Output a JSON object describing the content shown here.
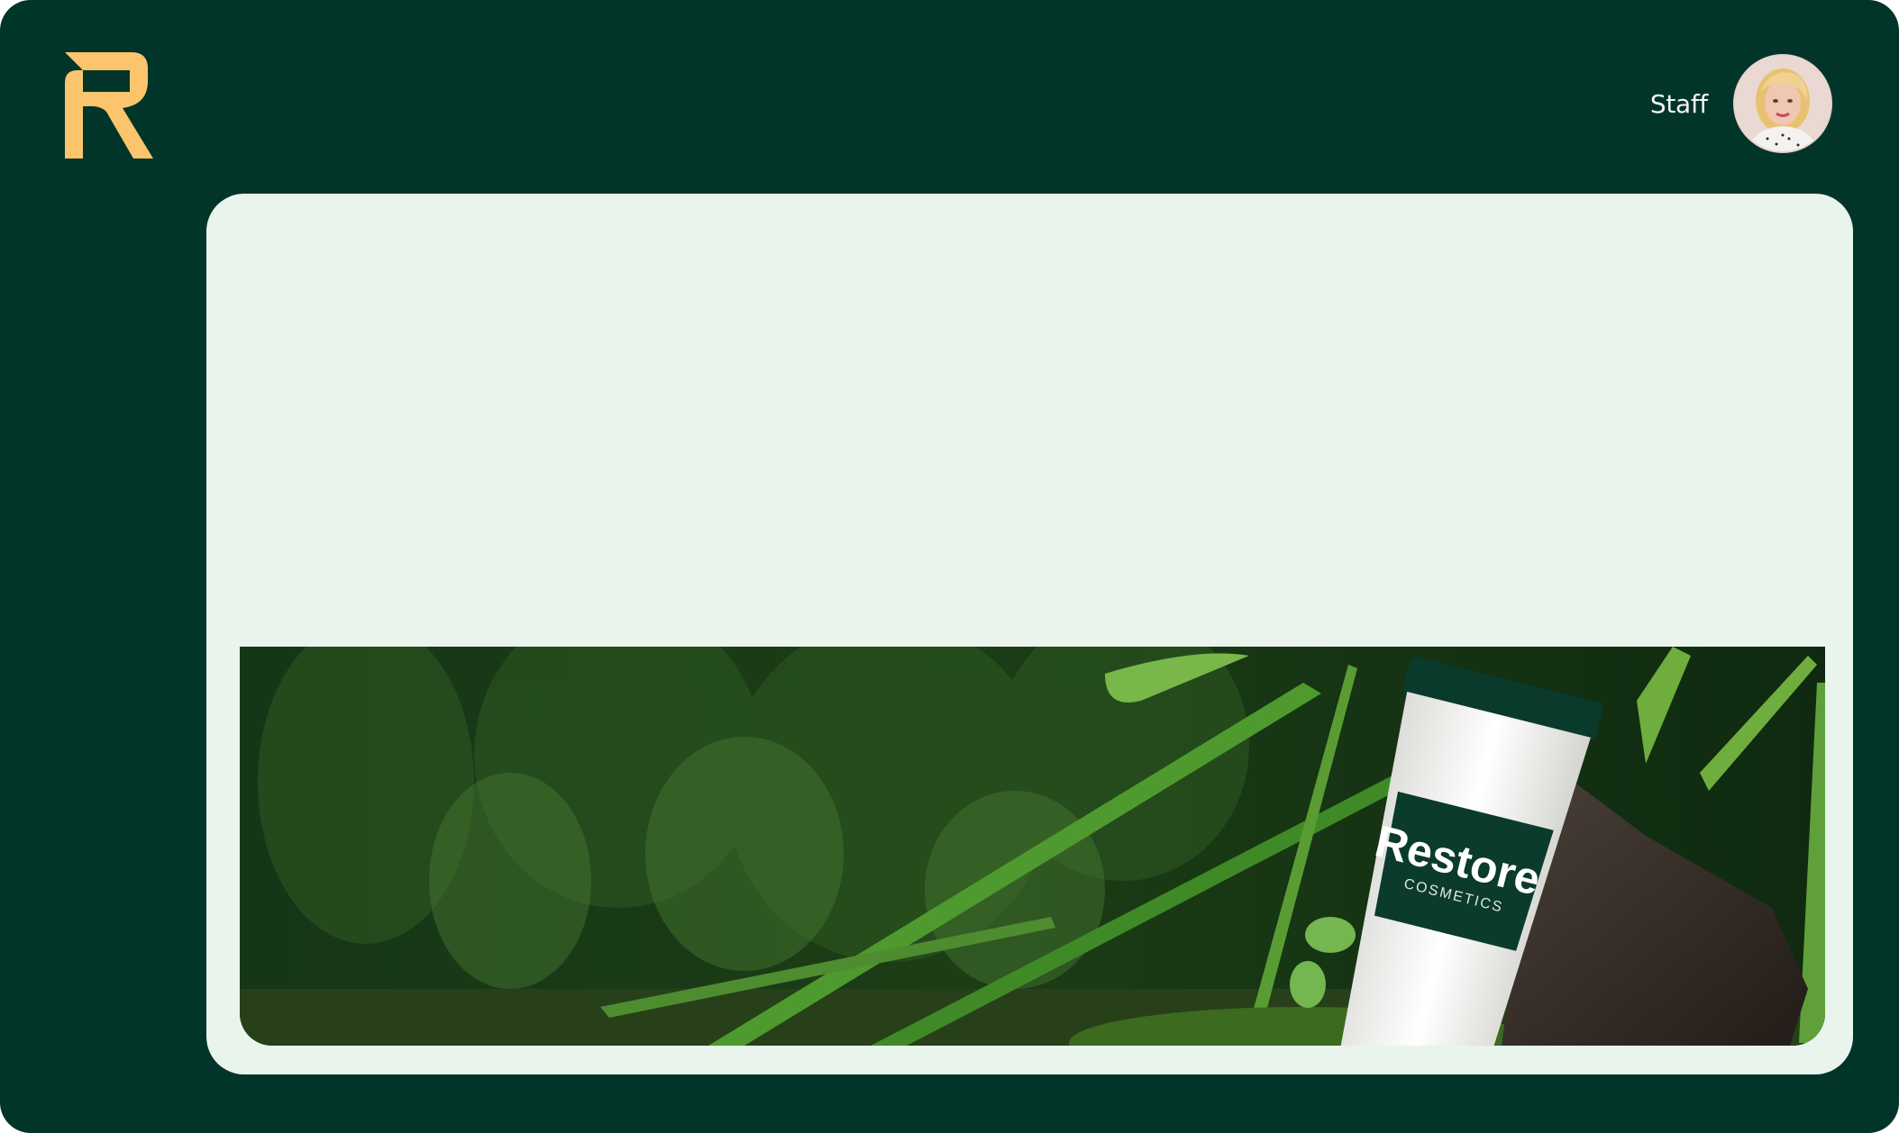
{
  "header": {
    "logo_icon": "restore-r-logo-icon",
    "logo_color": "#fcc46c",
    "user_label": "Staff",
    "avatar_icon": "user-avatar-photo"
  },
  "colors": {
    "app_background": "#02352a",
    "panel_background": "#e8f4ec",
    "text_light": "#f2f4ef"
  },
  "banner": {
    "brand_name": "Restore",
    "brand_tagline": "COSMETICS"
  }
}
